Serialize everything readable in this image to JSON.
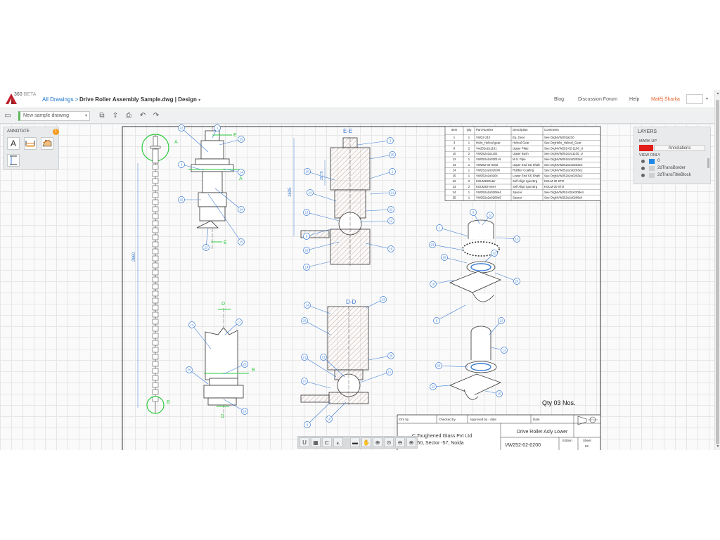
{
  "header": {
    "logo_text": "360",
    "logo_badge": "BETA",
    "breadcrumb": "All Drawings >",
    "title": "Drive Roller Assembly Sample.dwg | Design",
    "nav": [
      "Blog",
      "Discussion Forum",
      "Help"
    ],
    "user": "Matěj Škarka"
  },
  "toolbar": {
    "sheet": "New sample drawing"
  },
  "annotate": {
    "title": "ANNOTATE",
    "warn": "!",
    "text_tool": "A"
  },
  "layers": {
    "title": "LAYERS",
    "markup_label": "MARK UP",
    "markup_name": "Annotations",
    "view_only_label": "VIEW ONLY",
    "items": [
      {
        "name": "0",
        "color": "#1e88e5"
      },
      {
        "name": "2dTransBorder",
        "color": "#d0d0d0"
      },
      {
        "name": "2dTransTitleBlock",
        "color": "#d0d0d0"
      }
    ]
  },
  "drawing": {
    "section_ee": "E-E",
    "section_dd": "D-D",
    "label_a": "A",
    "label_b": "B",
    "label_e": "E",
    "label_d": "D",
    "dim_2660": "2660",
    "dim_1635": "1635",
    "dim_2975": "29,75",
    "qty": "Qty  03 Nos.",
    "bom_headers": [
      "Item",
      "Qty",
      "Part Number",
      "Description",
      "Comments"
    ],
    "bom_rows": [
      [
        "1",
        "1",
        "VW22-210",
        "Ep_Gear",
        "See DrgNVW202a210"
      ],
      [
        "3",
        "1",
        "Helix_Helical gear",
        "Helical Gear",
        "See DrgHelix_Helical_Gear"
      ],
      [
        "9",
        "2",
        "Vw252o2o1101",
        "Upper Plate",
        "See DrgNVW252-02-1100_U"
      ],
      [
        "10",
        "2",
        "VW252o2o1102",
        "Upper Bush",
        "See DrgNVW252o2o1100_U"
      ],
      [
        "12",
        "1",
        "VW252o2o0201-N",
        "M.S. Pipe",
        "See DrgNVW252o2o0203e2"
      ],
      [
        "13",
        "1",
        "VW252-02-0202",
        "Upper End SS Shaft",
        "See DrgNVW252o2o0203e2"
      ],
      [
        "14",
        "1",
        "VW252o2o0203N",
        "Rubber Coating",
        "See DrgNVW252o2o0203e2"
      ],
      [
        "15",
        "1",
        "VW252o2o0204",
        "Lower End SS Shaft",
        "See DrgNVW252o2o0203e2"
      ],
      [
        "22",
        "2",
        "KGLM30Outer",
        "Self Align Igus Brg",
        "KGLM-30 STD"
      ],
      [
        "23",
        "2",
        "KGLM30-Inner",
        "Self Align Igus Brg",
        "KGLM-30 STD"
      ],
      [
        "24",
        "1",
        "VW252o2o0208e4",
        "Spacer",
        "See DrgNVW252-02o0208e4"
      ],
      [
        "25",
        "1",
        "VW252o2o0208e5",
        "Spacer",
        "See DrgNVW252o2o0208e4"
      ]
    ],
    "title_block": {
      "drn_by": "Drn by",
      "checked_by": "Checked by",
      "approved_by": "Approved by - date",
      "date": "Date",
      "company_1": "C Toughened Glass Pvt Ltd",
      "company_2": "C-50, Sector -57, Noida",
      "title": "Drive Roller Asly Lower",
      "dwg_no": "VW252-02-0200",
      "edition": "Edition",
      "sheet": "Sheet",
      "sheet_no": "82",
      "cut_text": "C("
    },
    "balloons": {
      "side": [
        "22",
        "1",
        "25",
        "3",
        "14",
        "15",
        "24",
        "15",
        "23",
        "14",
        "13",
        "20",
        "23",
        "10"
      ],
      "ee": [
        "3",
        "25",
        "20",
        "1",
        "23",
        "21",
        "22",
        "13",
        "12",
        "9",
        "19",
        "15",
        "14"
      ],
      "dd": [
        "14",
        "23",
        "25",
        "20",
        "21",
        "13",
        "15",
        "22",
        "9",
        "10"
      ],
      "iso": [
        "9",
        "22",
        "13",
        "1",
        "23",
        "20",
        "22",
        "24",
        "10",
        "9",
        "13",
        "13",
        "25",
        "22",
        "15"
      ]
    }
  }
}
